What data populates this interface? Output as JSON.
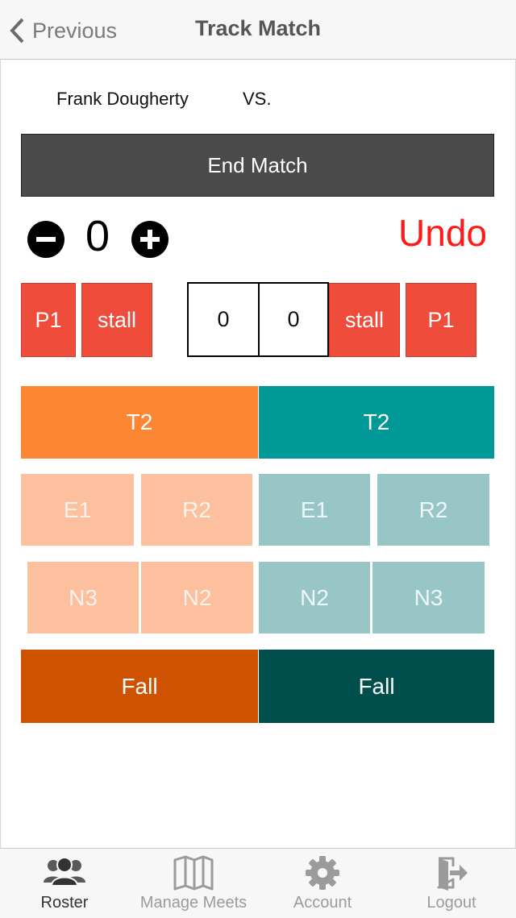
{
  "header": {
    "back_label": "Previous",
    "title": "Track Match"
  },
  "match": {
    "wrestler_name": "Frank Dougherty",
    "vs_label": "VS.",
    "end_match_label": "End Match",
    "period_counter": "0",
    "undo_label": "Undo"
  },
  "penalty_row": {
    "left_p1": "P1",
    "left_stall": "stall",
    "score_left": "0",
    "score_right": "0",
    "right_stall": "stall",
    "right_p1": "P1"
  },
  "scoring": {
    "left": {
      "takedown": "T2",
      "escape": "E1",
      "reversal": "R2",
      "nearfall3": "N3",
      "nearfall2": "N2",
      "fall": "Fall"
    },
    "right": {
      "takedown": "T2",
      "escape": "E1",
      "reversal": "R2",
      "nearfall2": "N2",
      "nearfall3": "N3",
      "fall": "Fall"
    }
  },
  "colors": {
    "left_primary": "#fb8634",
    "right_primary": "#019898",
    "penalty_red": "#ef4c3c",
    "undo_red": "#ff1a1a"
  },
  "tabbar": {
    "items": [
      {
        "label": "Roster",
        "icon": "roster-icon",
        "active": true
      },
      {
        "label": "Manage Meets",
        "icon": "map-icon",
        "active": false
      },
      {
        "label": "Account",
        "icon": "gear-icon",
        "active": false
      },
      {
        "label": "Logout",
        "icon": "logout-icon",
        "active": false
      }
    ]
  }
}
